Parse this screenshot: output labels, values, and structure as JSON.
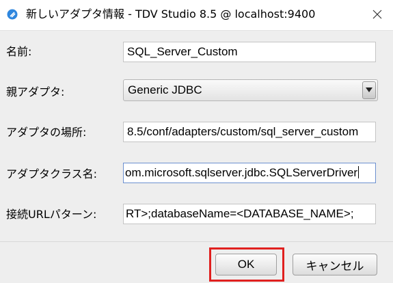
{
  "window": {
    "title": "新しいアダプタ情報 - TDV Studio 8.5 @ localhost:9400",
    "icon": "tdv-studio-icon",
    "close_icon": "close-icon"
  },
  "form": {
    "name": {
      "label": "名前:",
      "value": "SQL_Server_Custom"
    },
    "parent_adapter": {
      "label": "親アダプタ:",
      "value": "Generic JDBC"
    },
    "adapter_location": {
      "label": "アダプタの場所:",
      "value": "8.5/conf/adapters/custom/sql_server_custom"
    },
    "adapter_class": {
      "label": "アダプタクラス名:",
      "value": "om.microsoft.sqlserver.jdbc.SQLServerDriver"
    },
    "url_pattern": {
      "label": "接続URLパターン:",
      "value": "RT>;databaseName=<DATABASE_NAME>;"
    }
  },
  "buttons": {
    "ok": "OK",
    "cancel": "キャンセル"
  },
  "colors": {
    "highlight": "#e0201f",
    "focus_border": "#6b8fcf"
  }
}
